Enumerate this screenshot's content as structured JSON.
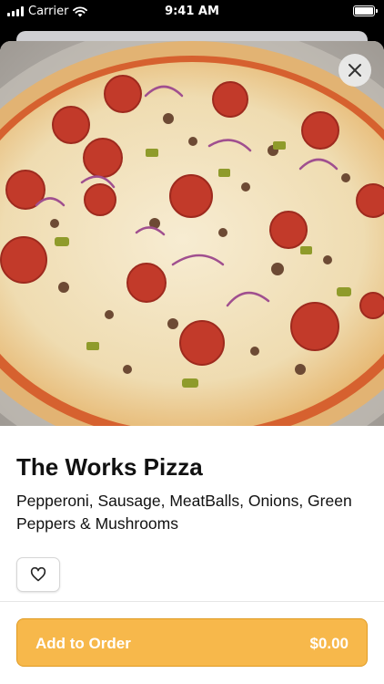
{
  "status_bar": {
    "carrier": "Carrier",
    "time": "9:41 AM"
  },
  "item": {
    "name": "The Works Pizza",
    "description": "Pepperoni, Sausage, MeatBalls, Onions, Green Peppers & Mushrooms",
    "image_icon": "pizza-photo"
  },
  "actions": {
    "close_icon": "close-icon",
    "favorite_icon": "heart-icon"
  },
  "order": {
    "label": "Add to Order",
    "price": "$0.00"
  },
  "colors": {
    "accent": "#f7b84b",
    "accent_border": "#e09b23",
    "text": "#111111"
  }
}
